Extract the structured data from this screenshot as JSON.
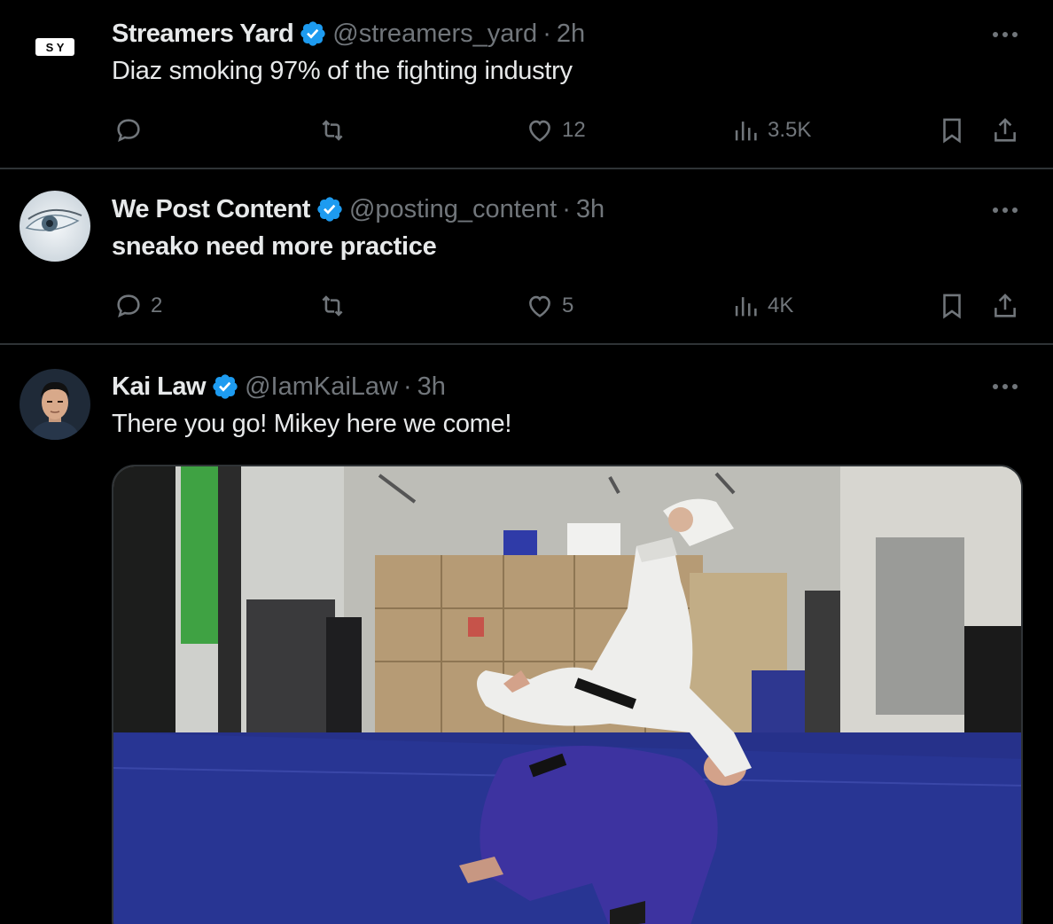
{
  "colors": {
    "background": "#000000",
    "text": "#e7e9ea",
    "muted": "#71767b",
    "verified": "#1d9bf0",
    "divider": "#2f3336"
  },
  "tweets": [
    {
      "avatar_text": "S Y",
      "name": "Streamers Yard",
      "handle": "@streamers_yard",
      "dot": "·",
      "time": "2h",
      "text": "Diaz smoking 97% of the fighting industry",
      "reply_count": "",
      "retweet_count": "",
      "like_count": "12",
      "view_count": "3.5K"
    },
    {
      "name": "We Post Content",
      "handle": "@posting_content",
      "dot": "·",
      "time": "3h",
      "text": "sneako need more practice",
      "reply_count": "2",
      "retweet_count": "",
      "like_count": "5",
      "view_count": "4K"
    },
    {
      "name": "Kai Law",
      "handle": "@IamKaiLaw",
      "dot": "·",
      "time": "3h",
      "text": "There you go! Mikey here we come!",
      "media": "judo-throw-video"
    }
  ],
  "icons": [
    "more-icon",
    "reply-icon",
    "retweet-icon",
    "like-icon",
    "views-icon",
    "bookmark-icon",
    "share-icon",
    "verified-icon"
  ]
}
